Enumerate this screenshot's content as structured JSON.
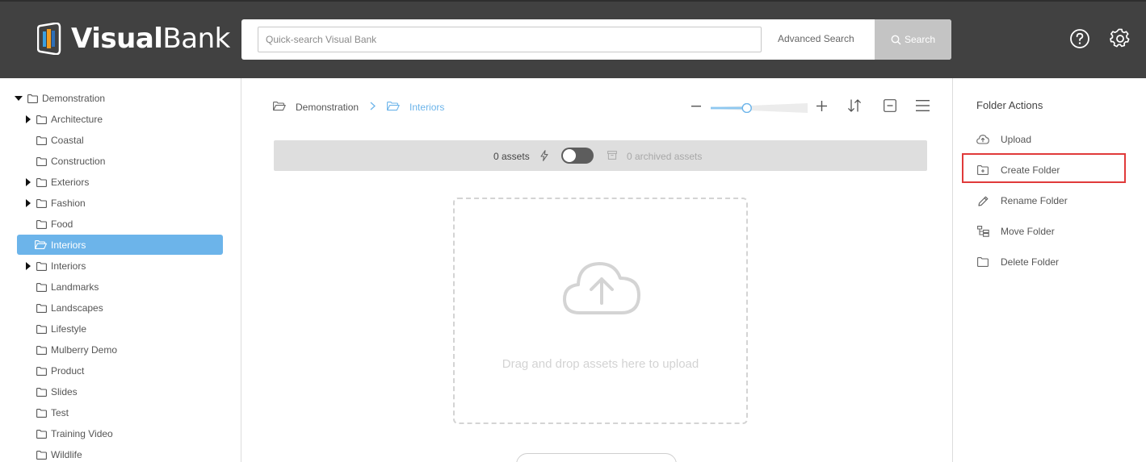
{
  "header": {
    "logo_bold": "Visual",
    "logo_light": "Bank",
    "search_placeholder": "Quick-search Visual Bank",
    "advanced_search": "Advanced Search",
    "search_button": "Search",
    "help_icon": "help-circle-icon",
    "settings_icon": "gear-icon"
  },
  "sidebar": {
    "root": "Demonstration",
    "items": [
      {
        "label": "Architecture",
        "expandable": true
      },
      {
        "label": "Coastal",
        "expandable": false
      },
      {
        "label": "Construction",
        "expandable": false
      },
      {
        "label": "Exteriors",
        "expandable": true
      },
      {
        "label": "Fashion",
        "expandable": true
      },
      {
        "label": "Food",
        "expandable": false
      },
      {
        "label": "Interiors",
        "expandable": false,
        "selected": true
      },
      {
        "label": "Interiors",
        "expandable": true
      },
      {
        "label": "Landmarks",
        "expandable": false
      },
      {
        "label": "Landscapes",
        "expandable": false
      },
      {
        "label": "Lifestyle",
        "expandable": false
      },
      {
        "label": "Mulberry Demo",
        "expandable": false
      },
      {
        "label": "Product",
        "expandable": false
      },
      {
        "label": "Slides",
        "expandable": false
      },
      {
        "label": "Test",
        "expandable": false
      },
      {
        "label": "Training Video",
        "expandable": false
      },
      {
        "label": "Wildlife",
        "expandable": false
      }
    ]
  },
  "main": {
    "breadcrumb": [
      "Demonstration",
      "Interiors"
    ],
    "zoom_level": 0.36,
    "assets_count": "0 assets",
    "archived_count": "0 archived assets",
    "dropzone_text": "Drag and drop assets here to upload"
  },
  "actions": {
    "title": "Folder Actions",
    "items": [
      {
        "label": "Upload",
        "icon": "cloud-upload-icon"
      },
      {
        "label": "Create Folder",
        "icon": "folder-plus-icon",
        "highlighted": true
      },
      {
        "label": "Rename Folder",
        "icon": "pencil-icon"
      },
      {
        "label": "Move Folder",
        "icon": "move-folder-icon"
      },
      {
        "label": "Delete Folder",
        "icon": "folder-delete-icon"
      }
    ]
  },
  "colors": {
    "header_bg": "#414141",
    "accent": "#6cb4ea",
    "highlight": "#e03a3a"
  }
}
